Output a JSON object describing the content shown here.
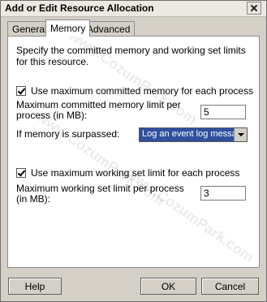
{
  "window": {
    "title": "Add or Edit Resource Allocation"
  },
  "tabs": [
    {
      "label": "General"
    },
    {
      "label": "Memory"
    },
    {
      "label": "Advanced"
    }
  ],
  "memory": {
    "description": "Specify the committed memory and working set limits for this resource.",
    "committed_checkbox_label": "Use maximum committed memory for each process",
    "committed_checked": true,
    "committed_limit_label": "Maximum committed memory limit per process (in MB):",
    "committed_limit_value": "5",
    "surpassed_label": "If memory is surpassed:",
    "surpassed_selected": "Log an event log message",
    "working_checkbox_label": "Use maximum working set limit for each process",
    "working_checked": true,
    "working_limit_label": "Maximum working set limit per process (in MB):",
    "working_limit_value": "3"
  },
  "buttons": {
    "help": "Help",
    "ok": "OK",
    "cancel": "Cancel"
  },
  "watermark": "www.CozumPark.com",
  "colors": {
    "select_highlight": "#2f4f9f",
    "dialog_bg": "#d4d0c8",
    "panel_bg": "#ffffff"
  }
}
